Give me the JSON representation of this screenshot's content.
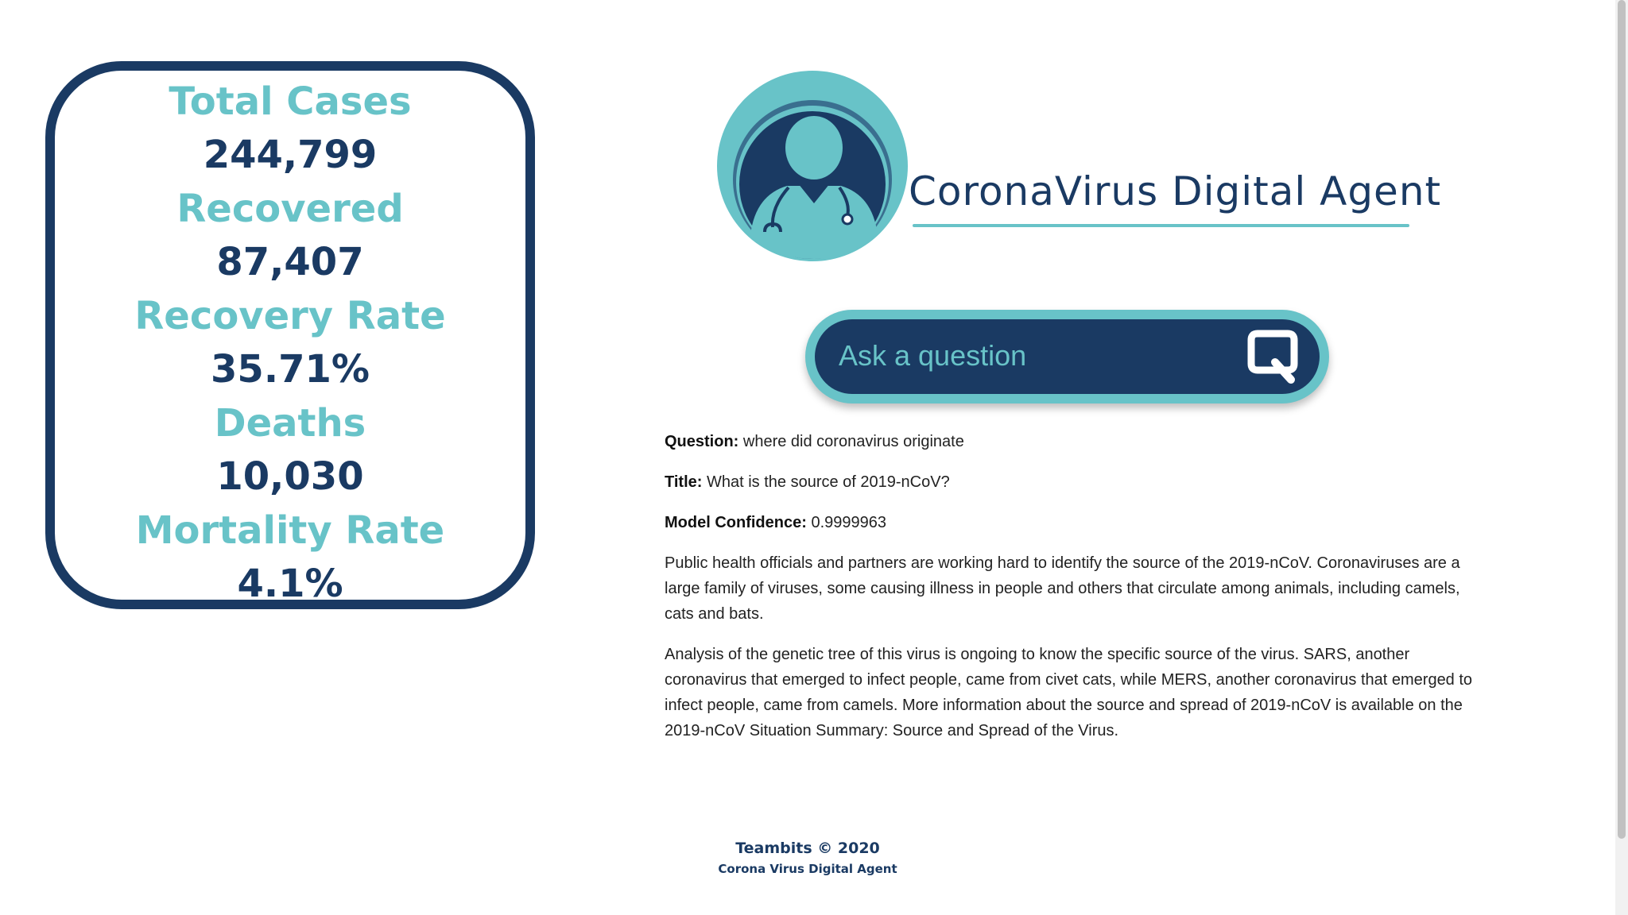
{
  "stats": [
    {
      "label": "Total Cases",
      "value": "244,799"
    },
    {
      "label": "Recovered",
      "value": "87,407"
    },
    {
      "label": "Recovery Rate",
      "value": "35.71%"
    },
    {
      "label": "Deaths",
      "value": "10,030"
    },
    {
      "label": "Mortality Rate",
      "value": "4.1%"
    }
  ],
  "brand": {
    "title": "CoronaVirus Digital Agent"
  },
  "search": {
    "placeholder": "Ask a question",
    "value": ""
  },
  "answer": {
    "question_label": "Question:",
    "question": "where did coronavirus originate",
    "title_label": "Title:",
    "title": "What is the source of 2019-nCoV?",
    "confidence_label": "Model Confidence:",
    "confidence": "0.9999963",
    "paragraph1": "Public health officials and partners are working hard to identify the source of the 2019-nCoV. Coronaviruses are a large family of viruses, some causing illness in people and others that circulate among animals, including camels, cats and bats.",
    "paragraph2": "Analysis of the genetic tree of this virus is ongoing to know the specific source of the virus. SARS, another coronavirus that emerged to infect people, came from civet cats, while MERS, another coronavirus that emerged to infect people, came from camels. More information about the source and spread of 2019-nCoV is available on the 2019-nCoV Situation Summary: Source and Spread of the Virus."
  },
  "footer": {
    "line1": "Teambits © 2020",
    "line2": "Corona Virus Digital Agent"
  },
  "colors": {
    "navy": "#1a3a63",
    "teal": "#68c3c8"
  },
  "icons": {
    "logo": "doctor-avatar-icon",
    "search_button": "search-q-icon"
  }
}
